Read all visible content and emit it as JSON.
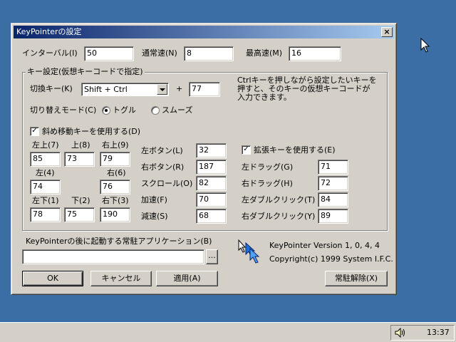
{
  "window": {
    "title": "KeyPointerの設定",
    "close_label": "×"
  },
  "interval": {
    "label": "インターバル(I)",
    "value": "50"
  },
  "normal_speed": {
    "label": "通常速(N)",
    "value": "8"
  },
  "max_speed": {
    "label": "最高速(M)",
    "value": "16"
  },
  "keygroup": {
    "title": "キー設定(仮想キーコードで指定)",
    "toggle_key_label": "切換キー(K)",
    "toggle_key_value": "Shift + Ctrl",
    "plus": "+",
    "toggle_key_code": "77",
    "hint": [
      "Ctrlキーを押しながら設定したいキーを",
      "押すと、そのキーの仮想キーコードが",
      "入力できます。"
    ],
    "mode_label": "切り替えモード(C)",
    "mode_toggle": "トグル",
    "mode_smooth": "スムーズ",
    "mode_selected": "トグル",
    "diagonal_label": "斜め移動キーを使用する(D)",
    "diagonal_checked": true,
    "up_left_label": "左上(7)",
    "up_left": "85",
    "up_label": "上(8)",
    "up": "73",
    "up_right_label": "右上(9)",
    "up_right": "79",
    "left_label": "左(4)",
    "left": "74",
    "right_label": "右(6)",
    "right": "76",
    "down_left_label": "左下(1)",
    "down_left": "78",
    "down_label": "下(2)",
    "down": "75",
    "down_right_label": "右下(3)",
    "down_right": "190",
    "left_button_label": "左ボタン(L)",
    "left_button": "32",
    "right_button_label": "右ボタン(R)",
    "right_button": "187",
    "scroll_label": "スクロール(O)",
    "scroll": "82",
    "accel_label": "加速(F)",
    "accel": "70",
    "decel_label": "減速(S)",
    "decel": "68",
    "ext_label": "拡張キーを使用する(E)",
    "ext_checked": true,
    "left_drag_label": "左ドラッグ(G)",
    "left_drag": "71",
    "right_drag_label": "右ドラッグ(H)",
    "right_drag": "72",
    "left_dbl_label": "左ダブルクリック(T)",
    "left_dbl": "84",
    "right_dbl_label": "右ダブルクリック(Y)",
    "right_dbl": "89"
  },
  "resident": {
    "label": "KeyPointerの後に起動する常駐アプリケーション(B)",
    "value": "",
    "browse_label": "..."
  },
  "about": {
    "version": "KeyPointer   Version 1, 0, 4, 4",
    "copyright": "Copyright(c)  1999 System I.F.C."
  },
  "buttons": {
    "ok": "OK",
    "cancel": "キャンセル",
    "apply": "適用(A)",
    "unload": "常駐解除(X)"
  },
  "tray": {
    "time": "13:37"
  },
  "colors": {
    "desktop": "#3a6ea5",
    "face": "#d4d0c8",
    "title_start": "#0a246a",
    "title_end": "#a6caf0"
  }
}
